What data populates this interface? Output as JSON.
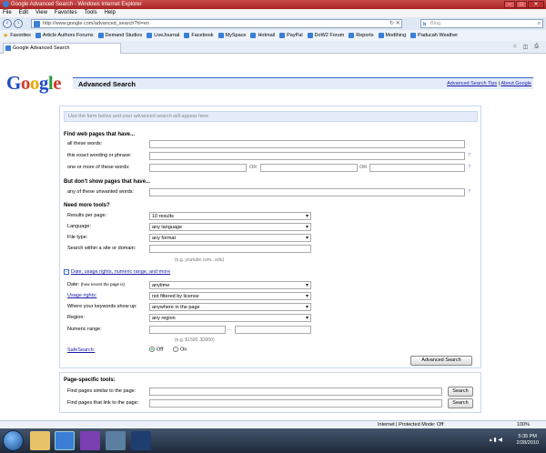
{
  "browser": {
    "window_title": "Google Advanced Search - Windows Internet Explorer",
    "menu": [
      "File",
      "Edit",
      "View",
      "Favorites",
      "Tools",
      "Help"
    ],
    "address": "http://www.google.com/advanced_search?hl=en",
    "search_placeholder": "Bing",
    "favorites_label": "Favorites",
    "favorites": [
      "Article Authors Forums",
      "Demand Studios",
      "LiveJournal",
      "Facebook",
      "MySpace",
      "Hotmail",
      "PayPal",
      "DoW2 Forum",
      "Reports",
      "Modthing",
      "Paducah Weather"
    ],
    "tab_title": "Google Advanced Search"
  },
  "page": {
    "logo": {
      "g1": "G",
      "o1": "o",
      "o2": "o",
      "g2": "g",
      "l": "l",
      "e": "e"
    },
    "title": "Advanced Search",
    "link_tips": "Advanced Search Tips",
    "link_sep": "|",
    "link_about": "About Google",
    "preview": "Use the form below and your advanced search will appear here",
    "find_heading": "Find web pages that have...",
    "all_words": "all these words:",
    "exact_phrase": "this exact wording or phrase:",
    "one_or_more": "one or more of these words:",
    "or_text": "OR",
    "exclude_heading": "But don't show pages that have...",
    "unwanted": "any of these unwanted words:",
    "more_tools": "Need more tools?",
    "results_per_page_label": "Results per page:",
    "results_per_page_value": "10 results",
    "language_label": "Language:",
    "language_value": "any language",
    "file_type_label": "File type:",
    "file_type_value": "any format",
    "site_label": "Search within a site or domain:",
    "site_hint": "(e.g. youtube.com, .edu)",
    "toggle_sign": "−",
    "options_link": "Date, usage rights, numeric range, and more",
    "date_label": "Date:",
    "date_hint": "(how recent the page is)",
    "date_value": "anytime",
    "usage_label": "Usage rights:",
    "usage_value": "not filtered by license",
    "where_label": "Where your keywords show up:",
    "where_value": "anywhere in the page",
    "region_label": "Region:",
    "region_value": "any region",
    "numeric_label": "Numeric range:",
    "range_sep": "...",
    "numeric_hint": "(e.g. $1500..$3000)",
    "safesearch_label": "SafeSearch:",
    "safe_off": "Off",
    "safe_on": "On",
    "submit": "Advanced Search",
    "tools_heading": "Page-specific tools:",
    "similar_label": "Find pages similar to the page:",
    "link_label": "Find pages that link to the page:",
    "search_button": "Search",
    "tip_icon": "?"
  },
  "status": {
    "zone": "Internet | Protected Mode: Off",
    "zoom": "100%",
    "time": "5:35 PM",
    "date": "2/28/2010"
  }
}
